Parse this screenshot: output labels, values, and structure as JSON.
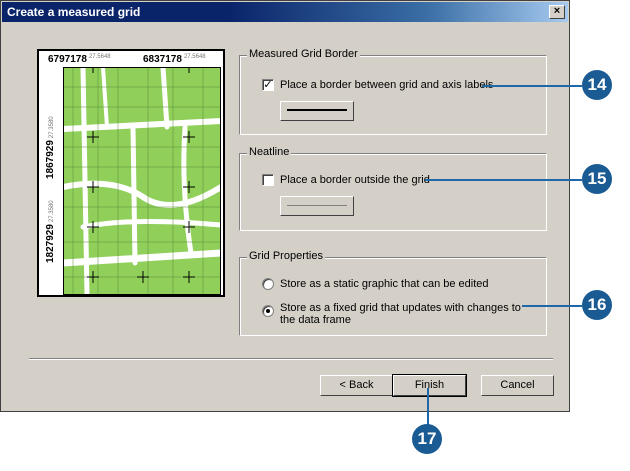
{
  "dialog": {
    "title": "Create a measured grid",
    "close_label": "×"
  },
  "preview": {
    "top_coords": [
      {
        "value": "6797178",
        "suffix": "27.5648"
      },
      {
        "value": "6837178",
        "suffix": "27.5648"
      }
    ],
    "side_coords": [
      {
        "value": "1867929",
        "suffix": "27.3580"
      },
      {
        "value": "1827929",
        "suffix": "27.3580"
      }
    ]
  },
  "measured_grid_border": {
    "legend": "Measured Grid Border",
    "checkbox_label": "Place a border between grid and axis labels",
    "checked": true
  },
  "neatline": {
    "legend": "Neatline",
    "checkbox_label": "Place a border outside the grid",
    "checked": false
  },
  "grid_properties": {
    "legend": "Grid Properties",
    "options": [
      {
        "label": "Store as a static graphic that can be edited",
        "selected": false
      },
      {
        "label": "Store as a fixed grid that updates with changes to the data frame",
        "selected": true
      }
    ]
  },
  "buttons": {
    "back": "< Back",
    "finish": "Finish",
    "cancel": "Cancel"
  },
  "callouts": [
    "14",
    "15",
    "16",
    "17"
  ],
  "colors": {
    "callout": "#1b5b94",
    "map_green": "#8fcf5a",
    "title_bar": "#0a246a"
  }
}
